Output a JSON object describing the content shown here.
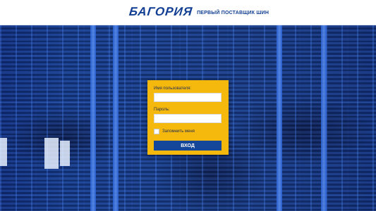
{
  "header": {
    "logo_text": "БАГОРИЯ",
    "tagline": "ПЕРВЫЙ ПОСТАВЩИК ШИН"
  },
  "login": {
    "username_label": "Имя пользователя:",
    "username_value": "",
    "password_label": "Пароль:",
    "password_value": "",
    "remember_label": "Запомнить меня",
    "remember_checked": false,
    "submit_label": "ВХОД"
  },
  "colors": {
    "brand_blue": "#123f93",
    "panel_yellow": "#f5b80d",
    "button_blue": "#14479a"
  }
}
